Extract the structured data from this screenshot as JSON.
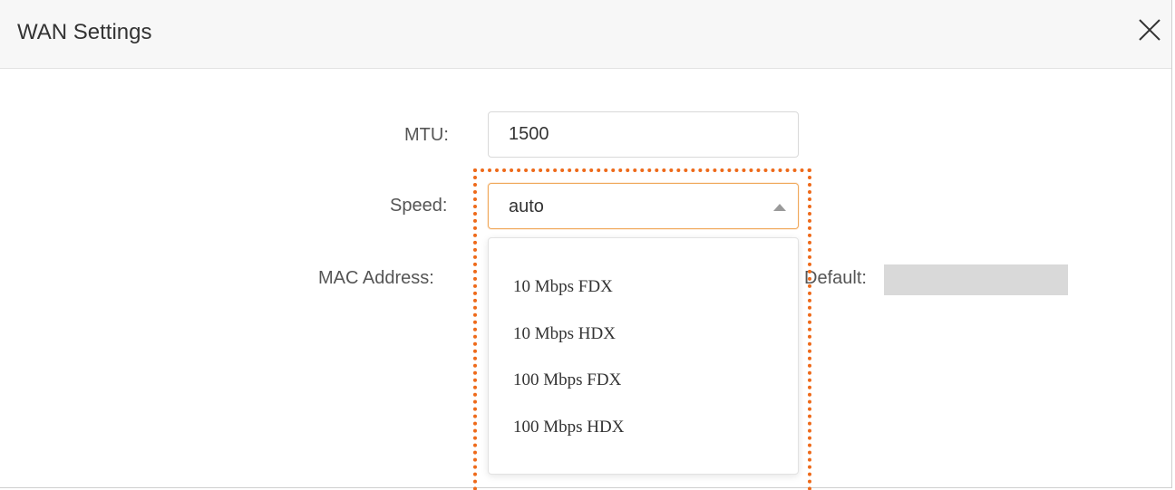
{
  "dialog": {
    "title": "WAN Settings",
    "close_icon": "close-icon"
  },
  "form": {
    "mtu": {
      "label": "MTU:",
      "value": "1500"
    },
    "speed": {
      "label": "Speed:",
      "selected": "auto",
      "caret_icon": "caret-up-icon",
      "options": [
        "10 Mbps FDX",
        "10 Mbps HDX",
        "100 Mbps FDX",
        "100 Mbps HDX"
      ]
    },
    "mac_address": {
      "label": "MAC Address:",
      "default_label": "Default:"
    }
  },
  "colors": {
    "highlight": "#ee6a1a",
    "focus_border": "#f0a85a",
    "header_bg": "#f7f7f7"
  }
}
